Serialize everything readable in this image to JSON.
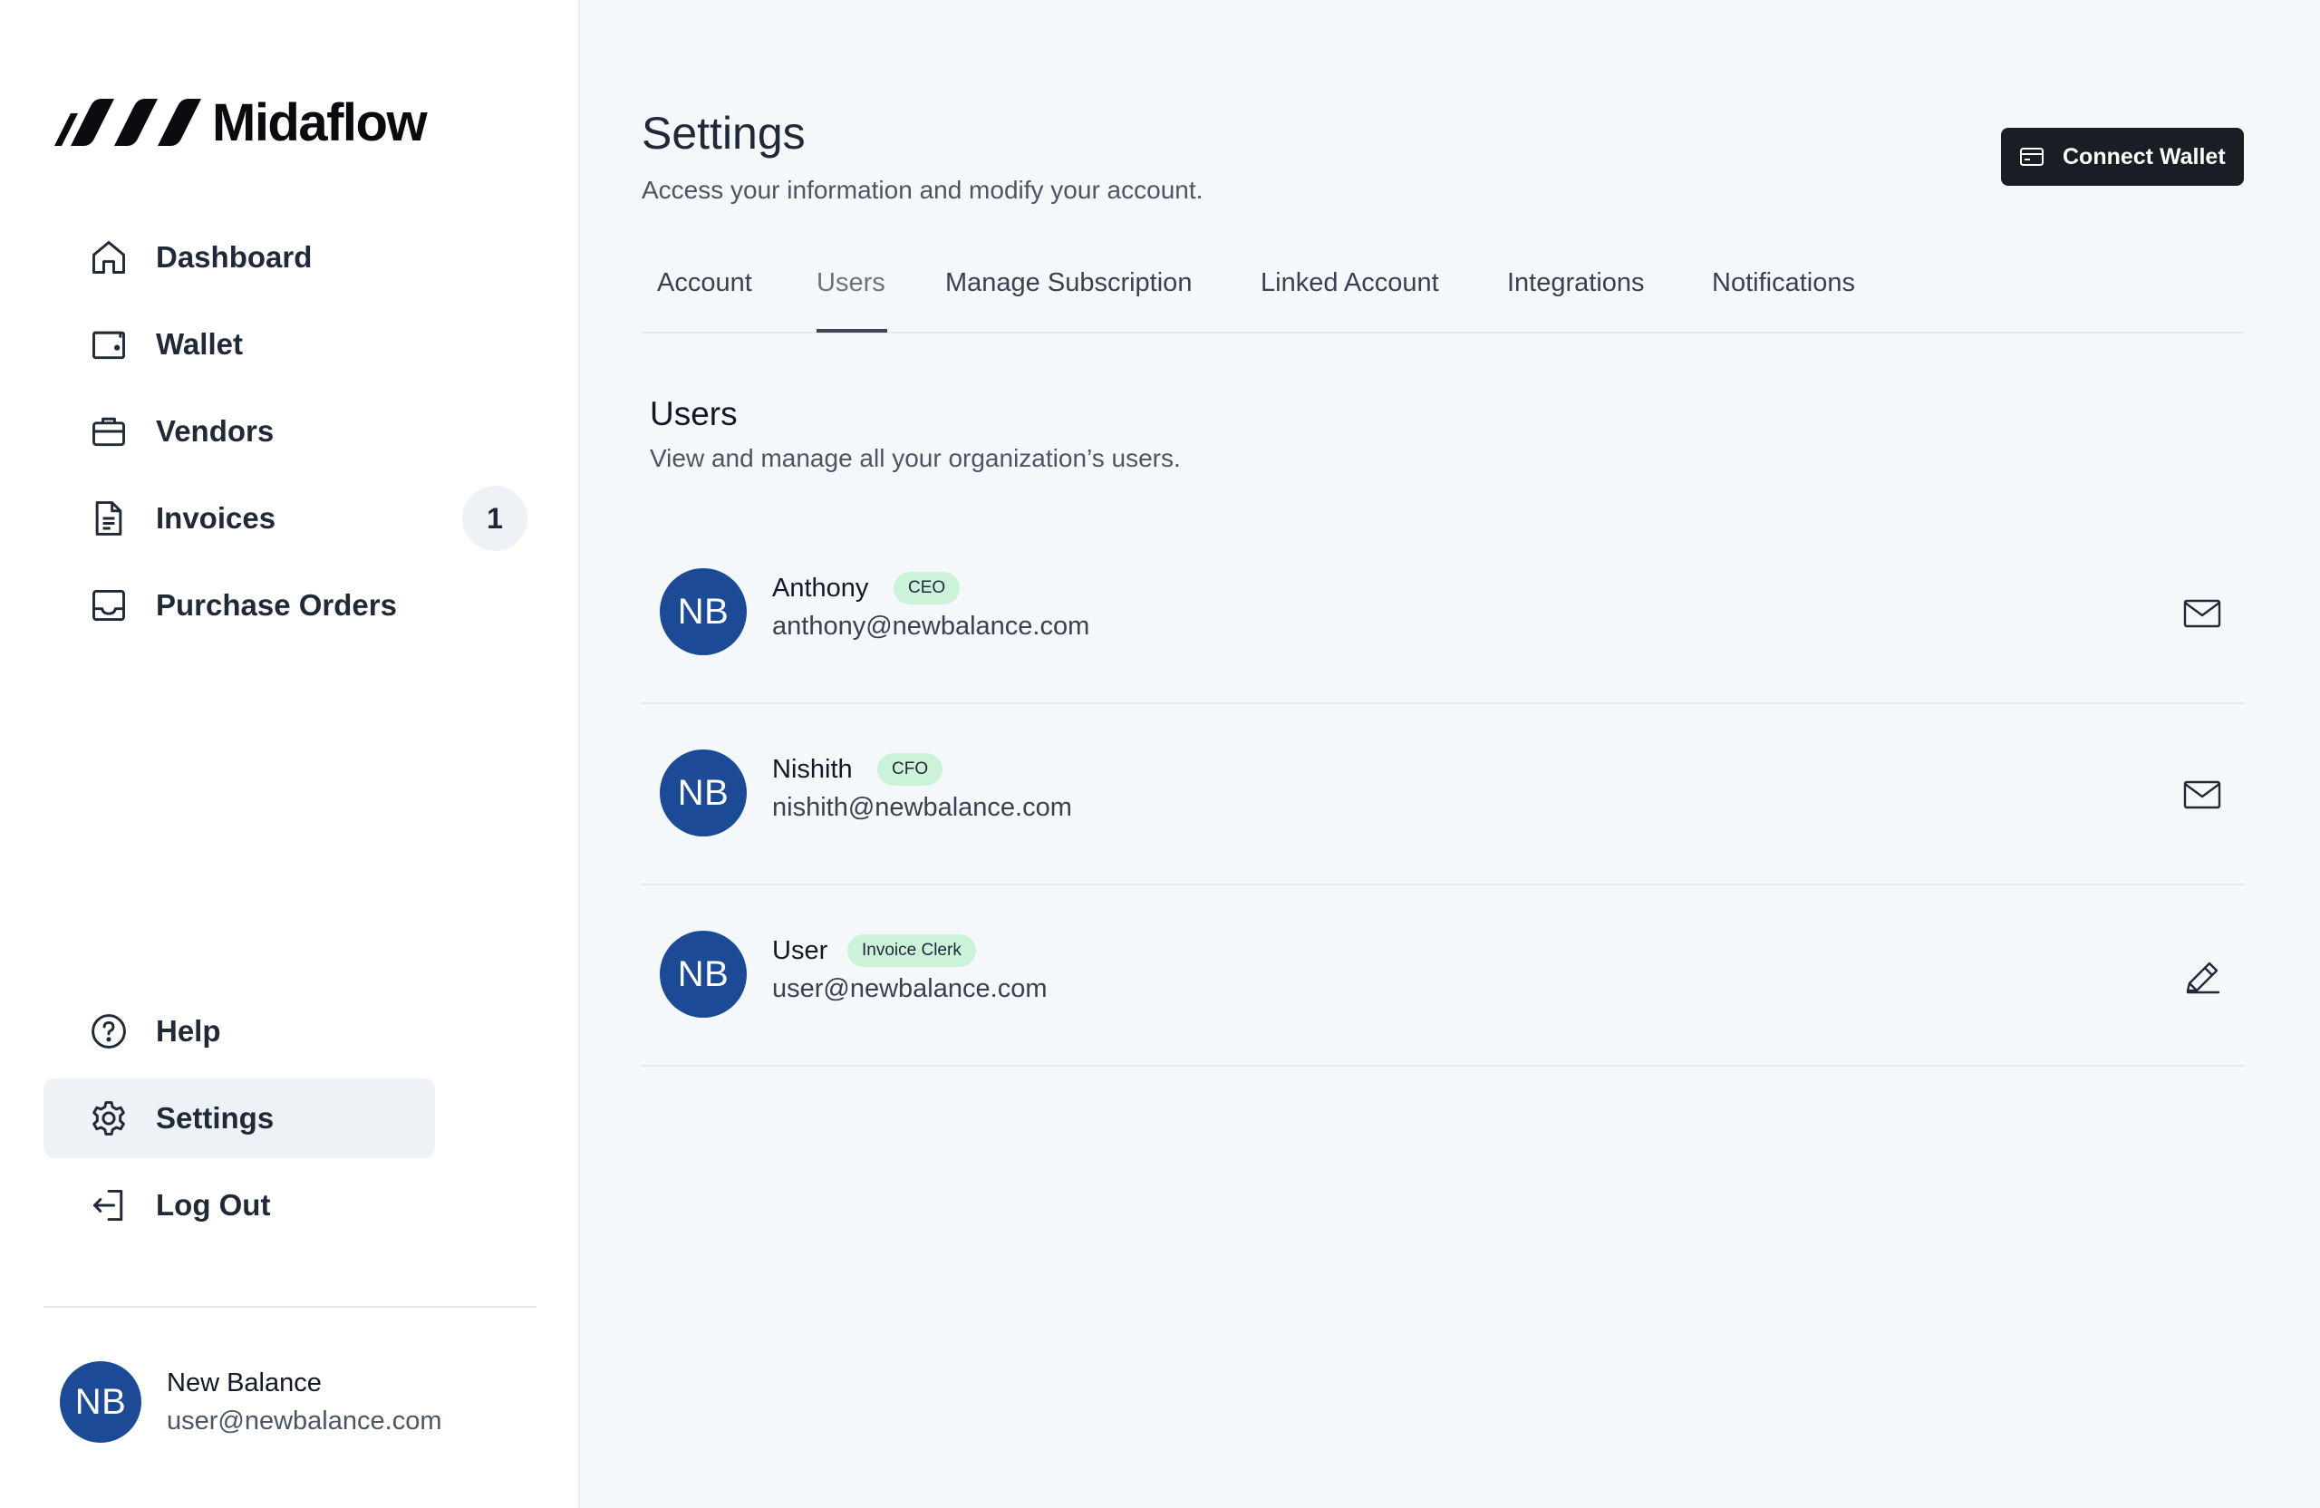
{
  "brand": {
    "name": "Midaflow"
  },
  "sidebar": {
    "items": [
      {
        "label": "Dashboard",
        "icon": "home-icon"
      },
      {
        "label": "Wallet",
        "icon": "wallet-icon"
      },
      {
        "label": "Vendors",
        "icon": "briefcase-icon"
      },
      {
        "label": "Invoices",
        "icon": "document-icon",
        "badge": "1"
      },
      {
        "label": "Purchase Orders",
        "icon": "inbox-icon"
      }
    ],
    "bottom_items": [
      {
        "label": "Help",
        "icon": "help-circle-icon"
      },
      {
        "label": "Settings",
        "icon": "gear-icon",
        "active": true
      },
      {
        "label": "Log Out",
        "icon": "logout-icon"
      }
    ],
    "profile": {
      "initials": "NB",
      "name": "New Balance",
      "email": "user@newbalance.com"
    }
  },
  "header": {
    "title": "Settings",
    "subtitle": "Access your information and modify your account.",
    "connect_wallet_label": "Connect Wallet"
  },
  "tabs": [
    {
      "label": "Account"
    },
    {
      "label": "Users",
      "active": true
    },
    {
      "label": "Manage Subscription"
    },
    {
      "label": "Linked Account"
    },
    {
      "label": "Integrations"
    },
    {
      "label": "Notifications"
    }
  ],
  "users_section": {
    "title": "Users",
    "subtitle": "View and manage all your organization’s users.",
    "users": [
      {
        "initials": "NB",
        "name": "Anthony",
        "role": "CEO",
        "email": "anthony@newbalance.com",
        "action_icon": "mail-icon"
      },
      {
        "initials": "NB",
        "name": "Nishith",
        "role": "CFO",
        "email": "nishith@newbalance.com",
        "action_icon": "mail-icon"
      },
      {
        "initials": "NB",
        "name": "User",
        "role": "Invoice Clerk",
        "email": "user@newbalance.com",
        "action_icon": "pencil-icon"
      }
    ]
  },
  "colors": {
    "avatar": "#1d4a96",
    "role_badge": "#cdf2da",
    "button_dark": "#1a1d24",
    "active_nav": "#eef1f5",
    "page_bg": "#f5f8fb"
  }
}
